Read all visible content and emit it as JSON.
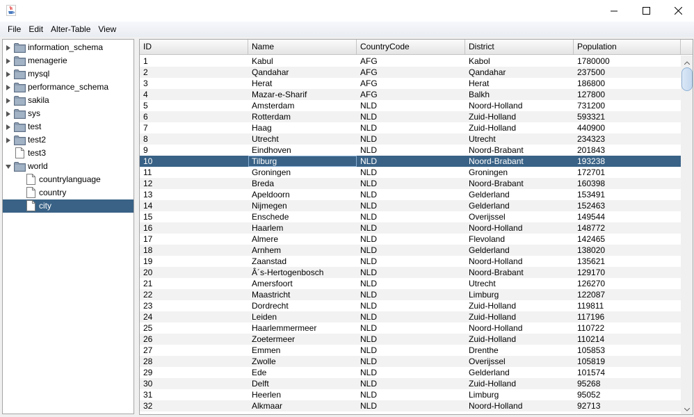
{
  "window": {
    "icon": "java-cup-icon",
    "controls": [
      "minimize-icon",
      "maximize-icon",
      "close-icon"
    ]
  },
  "menu": [
    "File",
    "Edit",
    "Alter-Table",
    "View"
  ],
  "tree": {
    "nodes": [
      {
        "label": "information_schema",
        "type": "folder",
        "expanded": false,
        "level": 0
      },
      {
        "label": "menagerie",
        "type": "folder",
        "expanded": false,
        "level": 0
      },
      {
        "label": "mysql",
        "type": "folder",
        "expanded": false,
        "level": 0
      },
      {
        "label": "performance_schema",
        "type": "folder",
        "expanded": false,
        "level": 0
      },
      {
        "label": "sakila",
        "type": "folder",
        "expanded": false,
        "level": 0
      },
      {
        "label": "sys",
        "type": "folder",
        "expanded": false,
        "level": 0
      },
      {
        "label": "test",
        "type": "folder",
        "expanded": false,
        "level": 0
      },
      {
        "label": "test2",
        "type": "folder",
        "expanded": false,
        "level": 0
      },
      {
        "label": "test3",
        "type": "file",
        "level": 0
      },
      {
        "label": "world",
        "type": "folder",
        "expanded": true,
        "level": 0
      },
      {
        "label": "countrylanguage",
        "type": "file",
        "level": 1
      },
      {
        "label": "country",
        "type": "file",
        "level": 1
      },
      {
        "label": "city",
        "type": "file",
        "level": 1,
        "selected": true
      }
    ]
  },
  "table": {
    "columns": [
      "ID",
      "Name",
      "CountryCode",
      "District",
      "Population"
    ],
    "selected_row": 9,
    "rows": [
      [
        "1",
        "Kabul",
        "AFG",
        "Kabol",
        "1780000"
      ],
      [
        "2",
        "Qandahar",
        "AFG",
        "Qandahar",
        "237500"
      ],
      [
        "3",
        "Herat",
        "AFG",
        "Herat",
        "186800"
      ],
      [
        "4",
        "Mazar-e-Sharif",
        "AFG",
        "Balkh",
        "127800"
      ],
      [
        "5",
        "Amsterdam",
        "NLD",
        "Noord-Holland",
        "731200"
      ],
      [
        "6",
        "Rotterdam",
        "NLD",
        "Zuid-Holland",
        "593321"
      ],
      [
        "7",
        "Haag",
        "NLD",
        "Zuid-Holland",
        "440900"
      ],
      [
        "8",
        "Utrecht",
        "NLD",
        "Utrecht",
        "234323"
      ],
      [
        "9",
        "Eindhoven",
        "NLD",
        "Noord-Brabant",
        "201843"
      ],
      [
        "10",
        "Tilburg",
        "NLD",
        "Noord-Brabant",
        "193238"
      ],
      [
        "11",
        "Groningen",
        "NLD",
        "Groningen",
        "172701"
      ],
      [
        "12",
        "Breda",
        "NLD",
        "Noord-Brabant",
        "160398"
      ],
      [
        "13",
        "Apeldoorn",
        "NLD",
        "Gelderland",
        "153491"
      ],
      [
        "14",
        "Nijmegen",
        "NLD",
        "Gelderland",
        "152463"
      ],
      [
        "15",
        "Enschede",
        "NLD",
        "Overijssel",
        "149544"
      ],
      [
        "16",
        "Haarlem",
        "NLD",
        "Noord-Holland",
        "148772"
      ],
      [
        "17",
        "Almere",
        "NLD",
        "Flevoland",
        "142465"
      ],
      [
        "18",
        "Arnhem",
        "NLD",
        "Gelderland",
        "138020"
      ],
      [
        "19",
        "Zaanstad",
        "NLD",
        "Noord-Holland",
        "135621"
      ],
      [
        "20",
        "Â´s-Hertogenbosch",
        "NLD",
        "Noord-Brabant",
        "129170"
      ],
      [
        "21",
        "Amersfoort",
        "NLD",
        "Utrecht",
        "126270"
      ],
      [
        "22",
        "Maastricht",
        "NLD",
        "Limburg",
        "122087"
      ],
      [
        "23",
        "Dordrecht",
        "NLD",
        "Zuid-Holland",
        "119811"
      ],
      [
        "24",
        "Leiden",
        "NLD",
        "Zuid-Holland",
        "117196"
      ],
      [
        "25",
        "Haarlemmermeer",
        "NLD",
        "Noord-Holland",
        "110722"
      ],
      [
        "26",
        "Zoetermeer",
        "NLD",
        "Zuid-Holland",
        "110214"
      ],
      [
        "27",
        "Emmen",
        "NLD",
        "Drenthe",
        "105853"
      ],
      [
        "28",
        "Zwolle",
        "NLD",
        "Overijssel",
        "105819"
      ],
      [
        "29",
        "Ede",
        "NLD",
        "Gelderland",
        "101574"
      ],
      [
        "30",
        "Delft",
        "NLD",
        "Zuid-Holland",
        "95268"
      ],
      [
        "31",
        "Heerlen",
        "NLD",
        "Limburg",
        "95052"
      ],
      [
        "32",
        "Alkmaar",
        "NLD",
        "Noord-Holland",
        "92713"
      ]
    ]
  },
  "colors": {
    "selection": "#396286",
    "alt_row": "#f2f2f2",
    "folder": "#7d8fa3"
  }
}
